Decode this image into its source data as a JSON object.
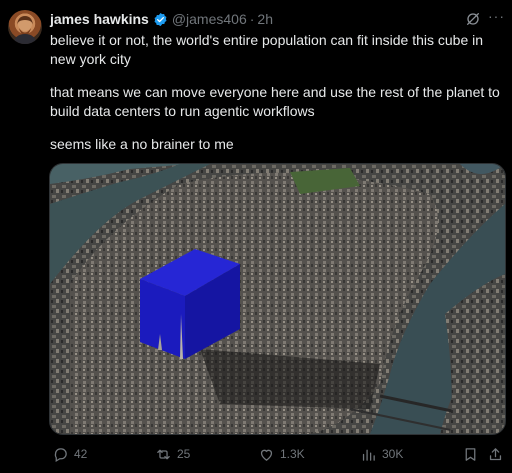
{
  "tweet": {
    "author_name": "james hawkins",
    "handle": "@james406",
    "separator": "·",
    "time": "2h",
    "more": "···",
    "paragraphs": [
      "believe it or not, the world's entire population can fit inside this cube in new york city",
      "that means we can move everyone here and use the rest of the planet to build data centers to run agentic workflows",
      "seems like a no brainer to me"
    ]
  },
  "actions": {
    "replies": "42",
    "reposts": "25",
    "likes": "1.3K",
    "views": "30K"
  },
  "colors": {
    "background": "#000000",
    "text": "#e7e9ea",
    "muted": "#71767b",
    "verified": "#1d9bf0",
    "cube": "#1f1fd6"
  },
  "icons": [
    "verified-badge-icon",
    "grok-icon",
    "more-icon",
    "reply-icon",
    "repost-icon",
    "like-icon",
    "views-icon",
    "bookmark-icon",
    "share-icon"
  ]
}
